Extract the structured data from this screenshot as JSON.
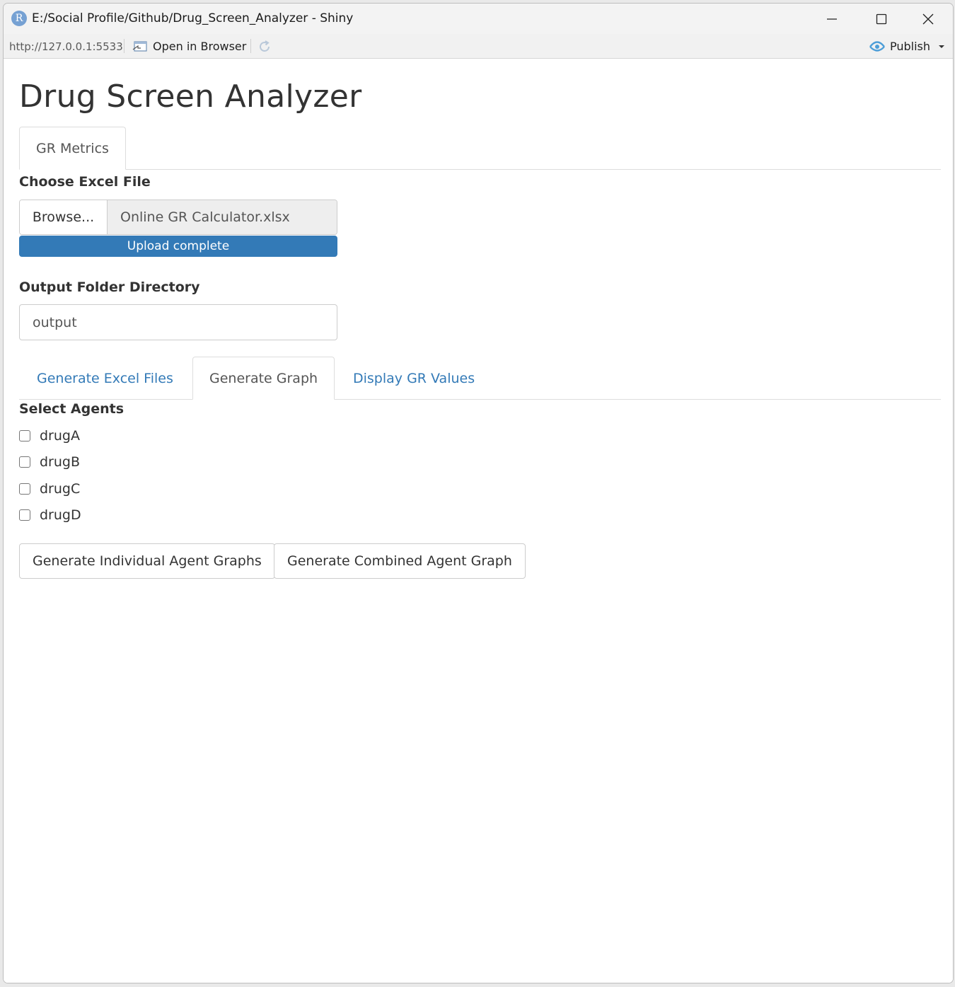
{
  "window": {
    "title": "E:/Social Profile/Github/Drug_Screen_Analyzer - Shiny",
    "app_icon_letter": "R"
  },
  "toolbar": {
    "url": "http://127.0.0.1:5533",
    "open_in_browser": "Open in Browser",
    "publish": "Publish"
  },
  "app": {
    "title": "Drug Screen Analyzer",
    "main_tabs": [
      {
        "label": "GR Metrics",
        "active": true
      }
    ],
    "file_input": {
      "label": "Choose Excel File",
      "browse_label": "Browse...",
      "file_name": "Online GR Calculator.xlsx",
      "progress_text": "Upload complete",
      "progress_fraction": 1.0
    },
    "output_dir": {
      "label": "Output Folder Directory",
      "value": "output"
    },
    "sub_tabs": [
      {
        "label": "Generate Excel Files",
        "active": false
      },
      {
        "label": "Generate Graph",
        "active": true
      },
      {
        "label": "Display GR Values",
        "active": false
      }
    ],
    "agents": {
      "label": "Select Agents",
      "options": [
        {
          "label": "drugA",
          "checked": false
        },
        {
          "label": "drugB",
          "checked": false
        },
        {
          "label": "drugC",
          "checked": false
        },
        {
          "label": "drugD",
          "checked": false
        }
      ]
    },
    "buttons": {
      "individual": "Generate Individual Agent Graphs",
      "combined": "Generate Combined Agent Graph"
    }
  },
  "colors": {
    "link": "#337ab7",
    "progress": "#337ab7",
    "text": "#333333"
  }
}
